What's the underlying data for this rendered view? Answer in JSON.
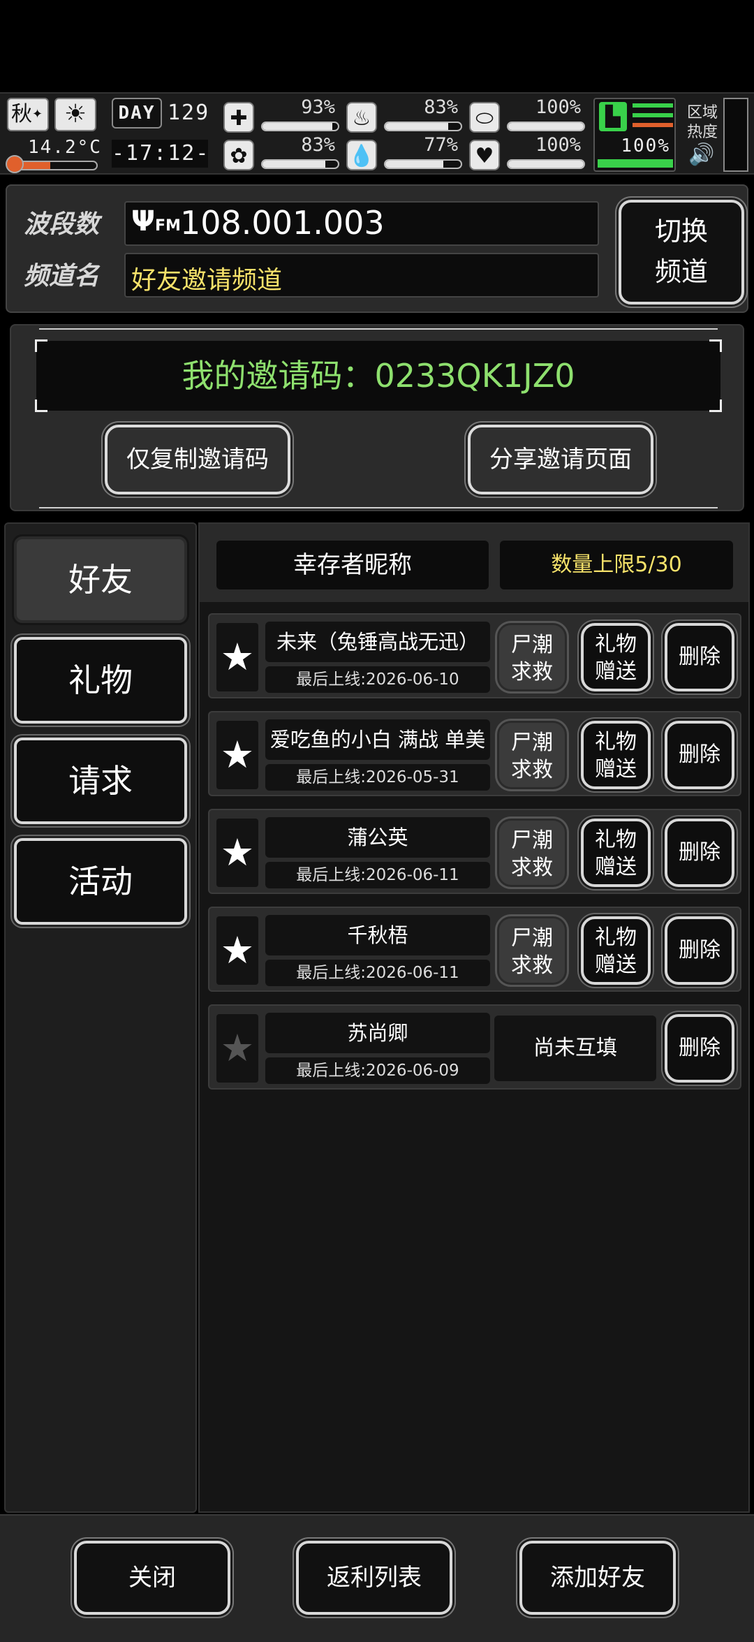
{
  "hud": {
    "season": "秋",
    "temperature": "14.2°C",
    "day_label": "DAY",
    "day_number": "129",
    "time": "-17:12-",
    "stats": {
      "health": "93%",
      "health_level": 0.93,
      "hunger": "83%",
      "hunger_level": 0.83,
      "pill": "100%",
      "pill_level": 1.0,
      "mind": "83%",
      "mind_level": 0.83,
      "water": "77%",
      "water_level": 0.77,
      "heart": "100%",
      "heart_level": 1.0,
      "stamina": "100%",
      "stamina_level": 1.0
    },
    "zone_heat_label": "区域热度",
    "colors": {
      "stamina": "#39d14a",
      "temp_bar": "#e0602c"
    }
  },
  "radio": {
    "band_label": "波段数",
    "band_value": "108.001.003",
    "channel_label": "频道名",
    "channel_value": "好友邀请频道",
    "switch_line1": "切换",
    "switch_line2": "频道"
  },
  "invite": {
    "code_text": "我的邀请码：0233QK1JZ0",
    "copy_button": "仅复制邀请码",
    "share_button": "分享邀请页面"
  },
  "tabs": [
    {
      "label": "好友",
      "active": true
    },
    {
      "label": "礼物",
      "active": false
    },
    {
      "label": "请求",
      "active": false
    },
    {
      "label": "活动",
      "active": false
    }
  ],
  "list_header": {
    "name_col": "幸存者昵称",
    "limit": "数量上限5/30",
    "limit_color": "#f6e26a"
  },
  "friends": [
    {
      "name": "未来（兔锤高战无迅）",
      "last_online": "最后上线:2026-06-10",
      "starred": true,
      "sos": [
        "尸潮",
        "求救"
      ],
      "gift": [
        "礼物",
        "赠送"
      ],
      "delete": "删除"
    },
    {
      "name": "爱吃鱼的小白 满战 单美",
      "last_online": "最后上线:2026-05-31",
      "starred": true,
      "sos": [
        "尸潮",
        "求救"
      ],
      "gift": [
        "礼物",
        "赠送"
      ],
      "delete": "删除"
    },
    {
      "name": "蒲公英",
      "last_online": "最后上线:2026-06-11",
      "starred": true,
      "sos": [
        "尸潮",
        "求救"
      ],
      "gift": [
        "礼物",
        "赠送"
      ],
      "delete": "删除"
    },
    {
      "name": "千秋梧",
      "last_online": "最后上线:2026-06-11",
      "starred": true,
      "sos": [
        "尸潮",
        "求救"
      ],
      "gift": [
        "礼物",
        "赠送"
      ],
      "delete": "删除"
    },
    {
      "name": "苏尚卿",
      "last_online": "最后上线:2026-06-09",
      "starred": false,
      "pending": "尚未互填",
      "delete": "删除"
    }
  ],
  "bottom": {
    "close": "关闭",
    "rebate_list": "返利列表",
    "add_friend": "添加好友"
  }
}
